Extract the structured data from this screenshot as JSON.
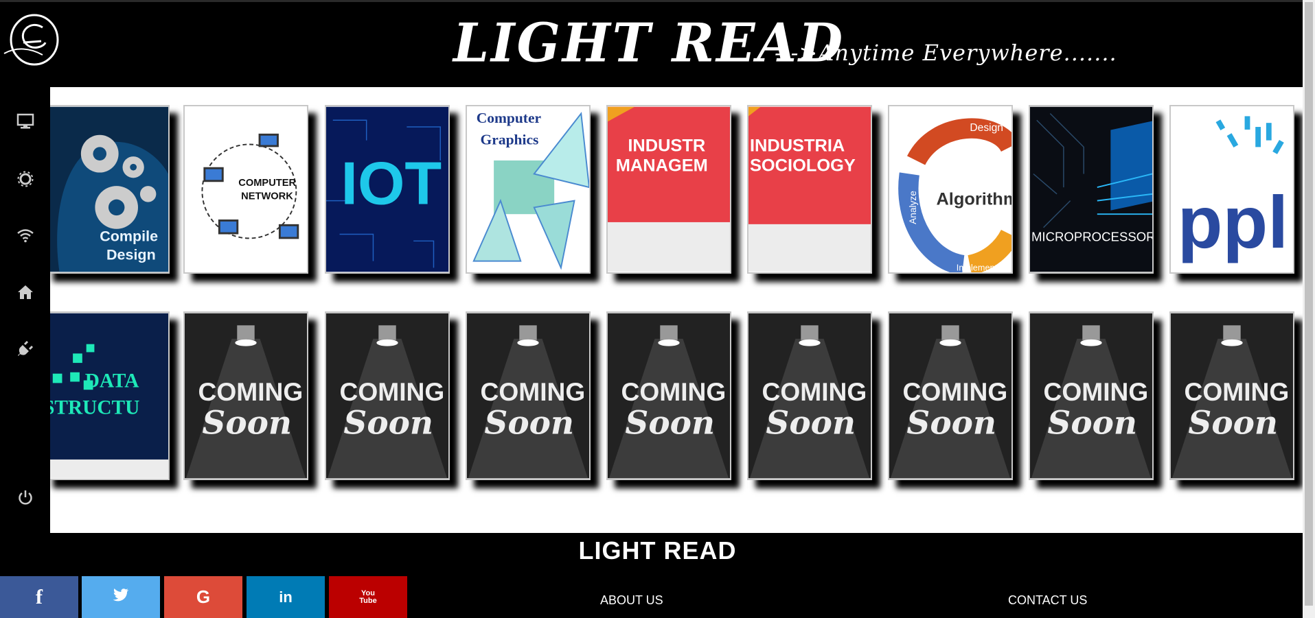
{
  "header": {
    "title": "LIGHT READ",
    "tagline": "--->Anytime Everywhere......."
  },
  "sidebar": {
    "icons": [
      "monitor-icon",
      "gear-icon",
      "wifi-icon",
      "home-icon",
      "plug-icon",
      "power-icon"
    ]
  },
  "books_row1": [
    {
      "name": "compiler-design",
      "lines": [
        "Compile",
        "Design"
      ]
    },
    {
      "name": "computer-network",
      "lines": [
        "COMPUTER",
        "NETWORK"
      ]
    },
    {
      "name": "iot",
      "lines": [
        "IOT"
      ]
    },
    {
      "name": "computer-graphics",
      "lines": [
        "Computer",
        "Graphics"
      ]
    },
    {
      "name": "industrial-management",
      "lines": [
        "INDUSTR",
        "MANAGEM"
      ]
    },
    {
      "name": "industrial-sociology",
      "lines": [
        "INDUSTRIA",
        "SOCIOLOGY"
      ]
    },
    {
      "name": "algorithm",
      "lines": [
        "Algorithm",
        "Design",
        "Analyze",
        "Implement"
      ]
    },
    {
      "name": "microprocessor",
      "lines": [
        "MICROPROCESSOR"
      ]
    },
    {
      "name": "ppl",
      "lines": [
        "ppl"
      ]
    }
  ],
  "books_row2": [
    {
      "name": "data-structure",
      "lines": [
        "DATA",
        "STRUCTU"
      ]
    },
    {
      "name": "coming-soon",
      "lines": [
        "COMING",
        "Soon"
      ]
    },
    {
      "name": "coming-soon",
      "lines": [
        "COMING",
        "Soon"
      ]
    },
    {
      "name": "coming-soon",
      "lines": [
        "COMING",
        "Soon"
      ]
    },
    {
      "name": "coming-soon",
      "lines": [
        "COMING",
        "Soon"
      ]
    },
    {
      "name": "coming-soon",
      "lines": [
        "COMING",
        "Soon"
      ]
    },
    {
      "name": "coming-soon",
      "lines": [
        "COMING",
        "Soon"
      ]
    },
    {
      "name": "coming-soon",
      "lines": [
        "COMING",
        "Soon"
      ]
    },
    {
      "name": "coming-soon",
      "lines": [
        "COMING",
        "Soon"
      ]
    }
  ],
  "footer": {
    "title": "LIGHT READ",
    "about_label": "ABOUT US",
    "contact_label": "CONTACT US",
    "social": [
      {
        "icon": "facebook-icon",
        "glyph": "f",
        "color": "#3b5998"
      },
      {
        "icon": "twitter-icon",
        "glyph": "t",
        "color": "#55acee"
      },
      {
        "icon": "google-plus-icon",
        "glyph": "G",
        "color": "#dd4b39"
      },
      {
        "icon": "linkedin-icon",
        "glyph": "in",
        "color": "#007bb5"
      },
      {
        "icon": "youtube-icon",
        "glyph": "You Tube",
        "color": "#bb0000"
      }
    ]
  }
}
